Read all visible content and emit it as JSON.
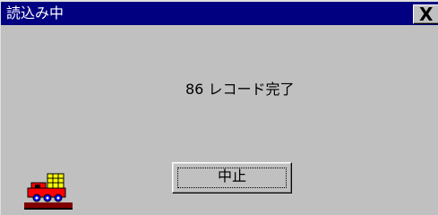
{
  "window": {
    "title": "読込み中"
  },
  "titlebar": {
    "close_label": "X"
  },
  "dialog": {
    "status_text": "86 レコード完了",
    "cancel_label": "中止"
  },
  "icons": {
    "app_icon": "train-loading-icon",
    "close_icon": "close-icon"
  },
  "colors": {
    "titlebar": "#000080",
    "face": "#c0c0c0",
    "title_text": "#ffffff"
  }
}
